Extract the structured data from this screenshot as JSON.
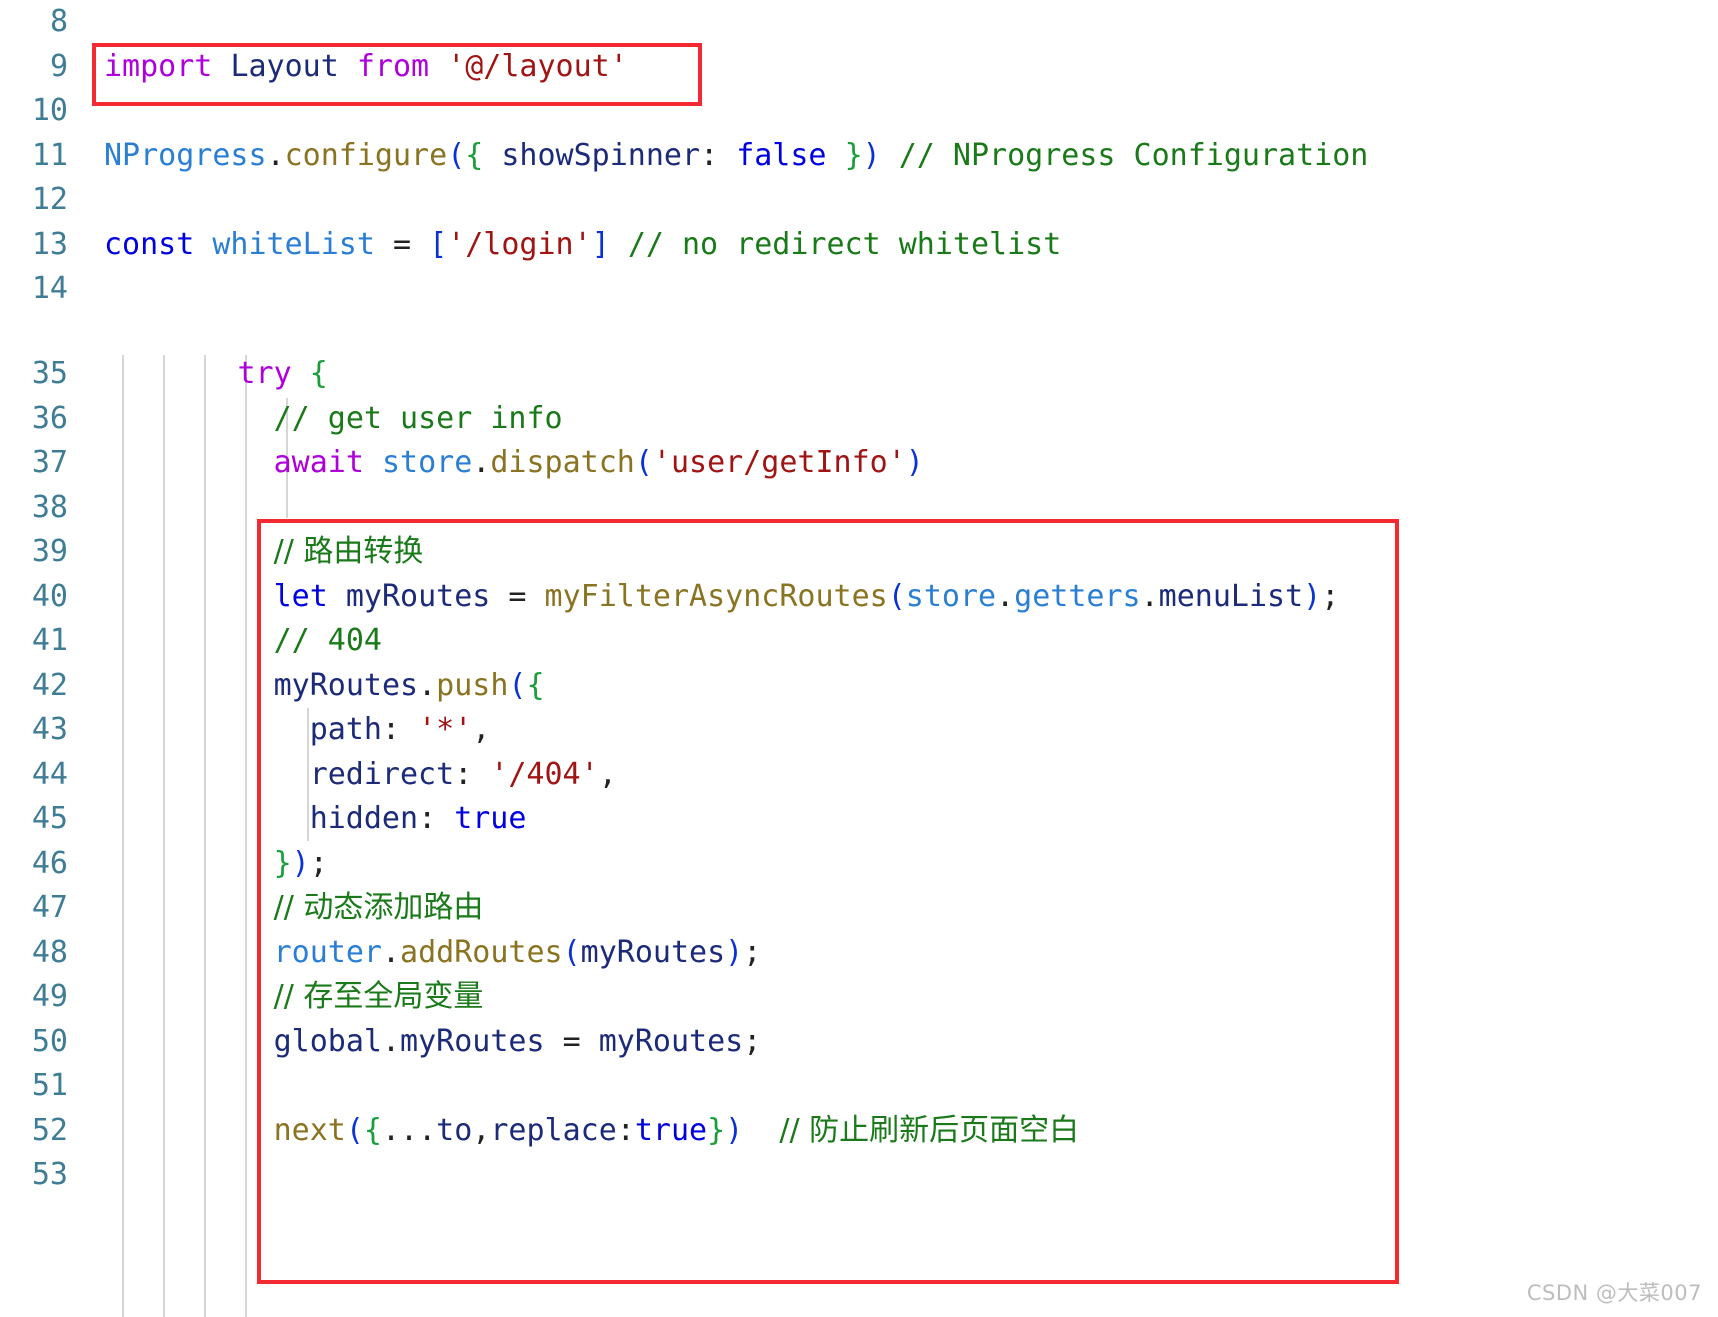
{
  "editor": {
    "language": "javascript",
    "colors": {
      "background": "#ffffff",
      "line_number": "#3f7c96",
      "keyword": "#af00db",
      "keyword_alt": "#0000e0",
      "identifier": "#1c2a7a",
      "module": "#2a7fd4",
      "function": "#8a7321",
      "string": "#a11414",
      "comment": "#1a7a1a",
      "annotation_box": "#f42a33",
      "indent_guide": "#d6d6d6",
      "watermark": "#bdbdbd"
    }
  },
  "top_block": {
    "lines": [
      {
        "number": "8",
        "tokens": []
      },
      {
        "number": "9",
        "tokens": [
          {
            "text": "import",
            "cls": "t-kw"
          },
          {
            "text": " ",
            "cls": "t-punct"
          },
          {
            "text": "Layout",
            "cls": "t-type"
          },
          {
            "text": " ",
            "cls": "t-punct"
          },
          {
            "text": "from",
            "cls": "t-kw"
          },
          {
            "text": " ",
            "cls": "t-punct"
          },
          {
            "text": "'@/layout'",
            "cls": "t-str"
          }
        ]
      },
      {
        "number": "10",
        "tokens": []
      },
      {
        "number": "11",
        "tokens": [
          {
            "text": "NProgress",
            "cls": "t-mod"
          },
          {
            "text": ".",
            "cls": "t-punct"
          },
          {
            "text": "configure",
            "cls": "t-fn"
          },
          {
            "text": "(",
            "cls": "t-paren"
          },
          {
            "text": "{",
            "cls": "t-brace"
          },
          {
            "text": " ",
            "cls": "t-punct"
          },
          {
            "text": "showSpinner",
            "cls": "t-id"
          },
          {
            "text": ": ",
            "cls": "t-punct"
          },
          {
            "text": "false",
            "cls": "t-kw2"
          },
          {
            "text": " ",
            "cls": "t-punct"
          },
          {
            "text": "}",
            "cls": "t-brace"
          },
          {
            "text": ")",
            "cls": "t-paren"
          },
          {
            "text": " ",
            "cls": "t-punct"
          },
          {
            "text": "// NProgress Configuration",
            "cls": "t-com"
          }
        ]
      },
      {
        "number": "12",
        "tokens": []
      },
      {
        "number": "13",
        "tokens": [
          {
            "text": "const",
            "cls": "t-kw2"
          },
          {
            "text": " ",
            "cls": "t-punct"
          },
          {
            "text": "whiteList",
            "cls": "t-mod"
          },
          {
            "text": " ",
            "cls": "t-punct"
          },
          {
            "text": "=",
            "cls": "t-op"
          },
          {
            "text": " ",
            "cls": "t-punct"
          },
          {
            "text": "[",
            "cls": "t-paren"
          },
          {
            "text": "'/login'",
            "cls": "t-str"
          },
          {
            "text": "]",
            "cls": "t-paren"
          },
          {
            "text": " ",
            "cls": "t-punct"
          },
          {
            "text": "// no redirect whitelist",
            "cls": "t-com"
          }
        ]
      },
      {
        "number": "14",
        "tokens": []
      }
    ]
  },
  "bottom_block": {
    "lines": [
      {
        "number": "35",
        "indent": 5,
        "tokens": [
          {
            "text": "try",
            "cls": "t-kw"
          },
          {
            "text": " ",
            "cls": "t-punct"
          },
          {
            "text": "{",
            "cls": "t-brace"
          }
        ]
      },
      {
        "number": "36",
        "indent": 6,
        "tokens": [
          {
            "text": "// get user info",
            "cls": "t-com"
          }
        ]
      },
      {
        "number": "37",
        "indent": 6,
        "tokens": [
          {
            "text": "await",
            "cls": "t-kw"
          },
          {
            "text": " ",
            "cls": "t-punct"
          },
          {
            "text": "store",
            "cls": "t-mod"
          },
          {
            "text": ".",
            "cls": "t-punct"
          },
          {
            "text": "dispatch",
            "cls": "t-fn"
          },
          {
            "text": "(",
            "cls": "t-paren"
          },
          {
            "text": "'user/getInfo'",
            "cls": "t-str"
          },
          {
            "text": ")",
            "cls": "t-paren"
          }
        ]
      },
      {
        "number": "38",
        "indent": 6,
        "tokens": []
      },
      {
        "number": "39",
        "indent": 6,
        "tokens": [
          {
            "text": "// 路由转换",
            "cls": "t-com t-cjk"
          }
        ]
      },
      {
        "number": "40",
        "indent": 6,
        "tokens": [
          {
            "text": "let",
            "cls": "t-kw2"
          },
          {
            "text": " ",
            "cls": "t-punct"
          },
          {
            "text": "myRoutes",
            "cls": "t-id"
          },
          {
            "text": " ",
            "cls": "t-punct"
          },
          {
            "text": "=",
            "cls": "t-op"
          },
          {
            "text": " ",
            "cls": "t-punct"
          },
          {
            "text": "myFilterAsyncRoutes",
            "cls": "t-fn"
          },
          {
            "text": "(",
            "cls": "t-paren"
          },
          {
            "text": "store",
            "cls": "t-mod"
          },
          {
            "text": ".",
            "cls": "t-punct"
          },
          {
            "text": "getters",
            "cls": "t-mod"
          },
          {
            "text": ".",
            "cls": "t-punct"
          },
          {
            "text": "menuList",
            "cls": "t-id"
          },
          {
            "text": ")",
            "cls": "t-paren"
          },
          {
            "text": ";",
            "cls": "t-punct"
          }
        ]
      },
      {
        "number": "41",
        "indent": 6,
        "tokens": [
          {
            "text": "// 404",
            "cls": "t-com"
          }
        ]
      },
      {
        "number": "42",
        "indent": 6,
        "tokens": [
          {
            "text": "myRoutes",
            "cls": "t-id"
          },
          {
            "text": ".",
            "cls": "t-punct"
          },
          {
            "text": "push",
            "cls": "t-fn"
          },
          {
            "text": "(",
            "cls": "t-paren"
          },
          {
            "text": "{",
            "cls": "t-brace"
          }
        ]
      },
      {
        "number": "43",
        "indent": 7,
        "tokens": [
          {
            "text": "path",
            "cls": "t-id"
          },
          {
            "text": ": ",
            "cls": "t-punct"
          },
          {
            "text": "'*'",
            "cls": "t-str"
          },
          {
            "text": ",",
            "cls": "t-punct"
          }
        ]
      },
      {
        "number": "44",
        "indent": 7,
        "tokens": [
          {
            "text": "redirect",
            "cls": "t-id"
          },
          {
            "text": ": ",
            "cls": "t-punct"
          },
          {
            "text": "'/404'",
            "cls": "t-str"
          },
          {
            "text": ",",
            "cls": "t-punct"
          }
        ]
      },
      {
        "number": "45",
        "indent": 7,
        "tokens": [
          {
            "text": "hidden",
            "cls": "t-id"
          },
          {
            "text": ": ",
            "cls": "t-punct"
          },
          {
            "text": "true",
            "cls": "t-kw2"
          }
        ]
      },
      {
        "number": "46",
        "indent": 6,
        "tokens": [
          {
            "text": "}",
            "cls": "t-brace"
          },
          {
            "text": ")",
            "cls": "t-paren"
          },
          {
            "text": ";",
            "cls": "t-punct"
          }
        ]
      },
      {
        "number": "47",
        "indent": 6,
        "tokens": [
          {
            "text": "// 动态添加路由",
            "cls": "t-com t-cjk"
          }
        ]
      },
      {
        "number": "48",
        "indent": 6,
        "tokens": [
          {
            "text": "router",
            "cls": "t-mod"
          },
          {
            "text": ".",
            "cls": "t-punct"
          },
          {
            "text": "addRoutes",
            "cls": "t-fn"
          },
          {
            "text": "(",
            "cls": "t-paren"
          },
          {
            "text": "myRoutes",
            "cls": "t-id"
          },
          {
            "text": ")",
            "cls": "t-paren"
          },
          {
            "text": ";",
            "cls": "t-punct"
          }
        ]
      },
      {
        "number": "49",
        "indent": 6,
        "tokens": [
          {
            "text": "// 存至全局变量",
            "cls": "t-com t-cjk"
          }
        ]
      },
      {
        "number": "50",
        "indent": 6,
        "tokens": [
          {
            "text": "global",
            "cls": "t-id"
          },
          {
            "text": ".",
            "cls": "t-punct"
          },
          {
            "text": "myRoutes",
            "cls": "t-id"
          },
          {
            "text": " ",
            "cls": "t-punct"
          },
          {
            "text": "=",
            "cls": "t-op"
          },
          {
            "text": " ",
            "cls": "t-punct"
          },
          {
            "text": "myRoutes",
            "cls": "t-id"
          },
          {
            "text": ";",
            "cls": "t-punct"
          }
        ]
      },
      {
        "number": "51",
        "indent": 6,
        "tokens": []
      },
      {
        "number": "52",
        "indent": 6,
        "tokens": [
          {
            "text": "next",
            "cls": "t-fn"
          },
          {
            "text": "(",
            "cls": "t-paren"
          },
          {
            "text": "{",
            "cls": "t-brace"
          },
          {
            "text": "...",
            "cls": "t-punct"
          },
          {
            "text": "to",
            "cls": "t-id"
          },
          {
            "text": ",",
            "cls": "t-punct"
          },
          {
            "text": "replace",
            "cls": "t-id"
          },
          {
            "text": ":",
            "cls": "t-punct"
          },
          {
            "text": "true",
            "cls": "t-kw2"
          },
          {
            "text": "}",
            "cls": "t-brace"
          },
          {
            "text": ")",
            "cls": "t-paren"
          },
          {
            "text": "  ",
            "cls": "t-punct"
          },
          {
            "text": "// 防止刷新后页面空白",
            "cls": "t-com t-cjk"
          }
        ]
      },
      {
        "number": "53",
        "indent": 5,
        "tokens": []
      }
    ]
  },
  "annotations": [
    {
      "name": "import-layout-highlight",
      "target_line": "9"
    },
    {
      "name": "dynamic-routes-highlight",
      "target_lines": "39-52"
    }
  ],
  "watermark": {
    "text": "CSDN @大菜007"
  }
}
